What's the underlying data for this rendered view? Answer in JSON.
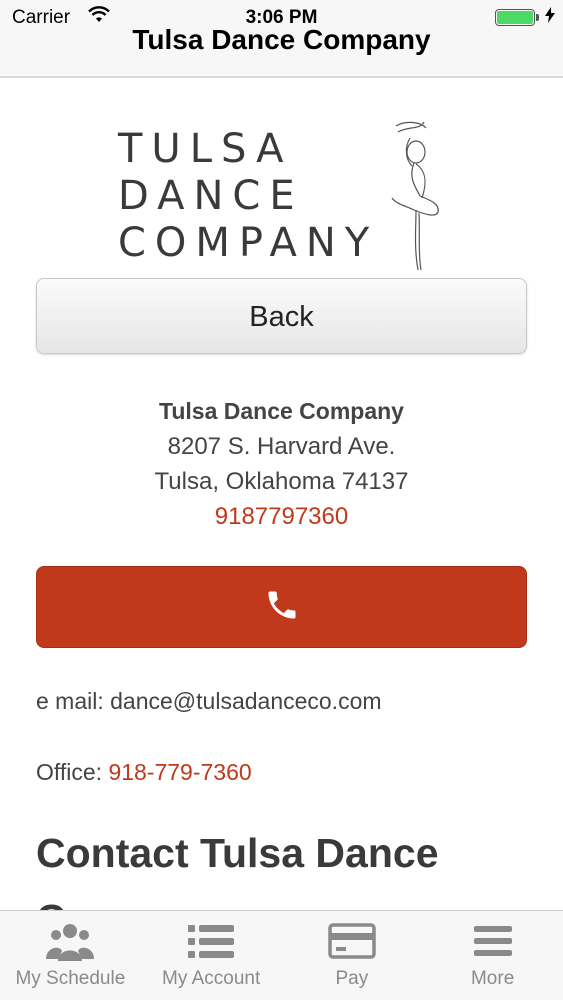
{
  "status_bar": {
    "carrier": "Carrier",
    "time": "3:06 PM",
    "wifi_icon": "wifi-icon",
    "battery_icon": "battery-icon",
    "charging_icon": "bolt-icon"
  },
  "header": {
    "title": "Tulsa Dance Company"
  },
  "logo": {
    "line1": "TULSA",
    "line2": "DANCE",
    "line3": "COMPANY",
    "icon": "dancer-icon"
  },
  "back_button": {
    "label": "Back"
  },
  "address": {
    "name": "Tulsa Dance Company",
    "street": "8207 S. Harvard Ave.",
    "city": "Tulsa, Oklahoma 74137",
    "phone": "9187797360"
  },
  "call_button": {
    "icon": "phone-icon",
    "color": "#c0391b"
  },
  "contact": {
    "email_line": "e mail: dance@tulsadanceco.com",
    "office_label": "Office: ",
    "office_phone": "918-779-7360",
    "heading": "Contact Tulsa Dance Company"
  },
  "tab_bar": {
    "tabs": [
      {
        "label": "My Schedule",
        "icon": "people-icon"
      },
      {
        "label": "My Account",
        "icon": "list-icon"
      },
      {
        "label": "Pay",
        "icon": "credit-card-icon"
      },
      {
        "label": "More",
        "icon": "menu-icon"
      }
    ]
  },
  "colors": {
    "accent": "#c0391b",
    "tab_inactive": "#8a8a8a"
  }
}
